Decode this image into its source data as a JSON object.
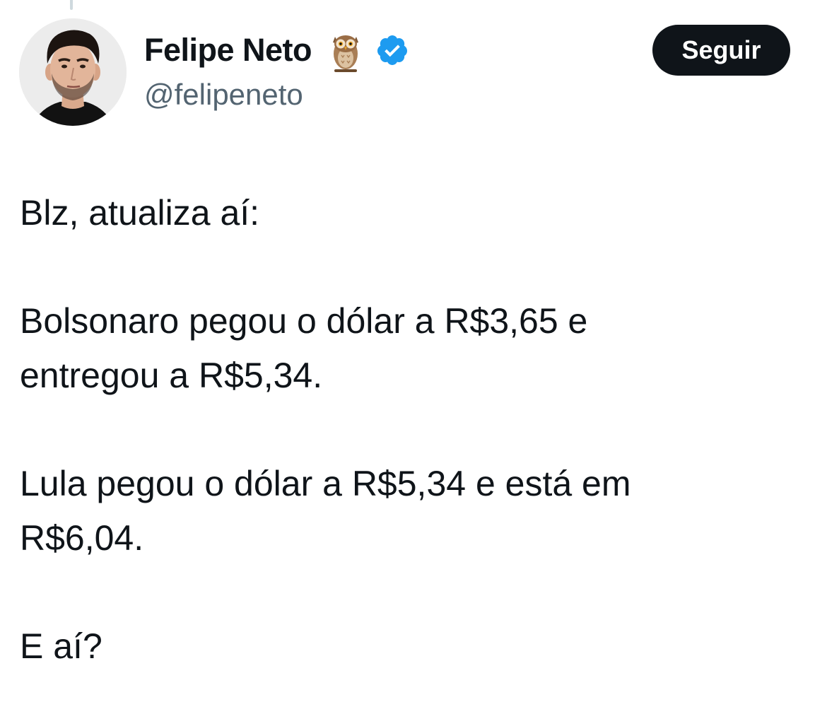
{
  "author": {
    "display_name": "Felipe Neto",
    "handle": "@felipeneto",
    "emoji_icon": "owl-icon",
    "verified_icon": "verified-badge-icon",
    "verified_color": "#1d9bf0"
  },
  "follow_button": {
    "label": "Seguir",
    "background": "#0f1419",
    "text_color": "#ffffff"
  },
  "tweet": {
    "paragraphs": [
      {
        "lines": [
          "Blz, atualiza aí:"
        ]
      },
      {
        "lines": [
          "Bolsonaro pegou o dólar a R$3,65 e",
          "entregou a R$5,34."
        ]
      },
      {
        "lines": [
          "Lula pegou o dólar a R$5,34 e está em",
          "R$6,04."
        ]
      },
      {
        "lines": [
          "E aí?"
        ]
      }
    ]
  },
  "colors": {
    "text_primary": "#0f1419",
    "text_secondary": "#536471",
    "background": "#ffffff"
  }
}
